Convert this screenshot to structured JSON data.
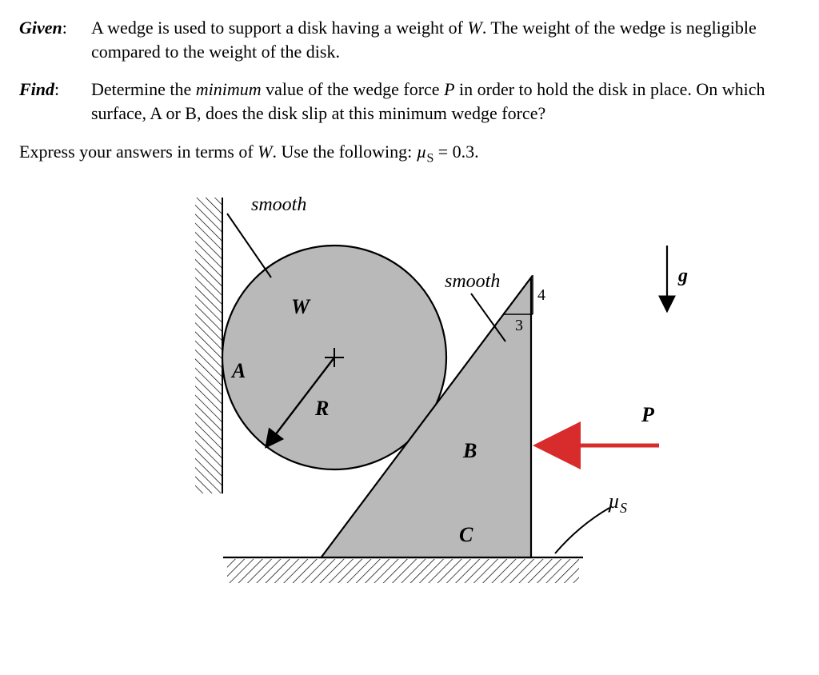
{
  "given": {
    "label": "Given",
    "text_a": "A wedge is used to support a disk having a weight of ",
    "W": "W",
    "text_b": ". The weight of the wedge is negligible compared to the weight of the disk."
  },
  "find": {
    "label": "Find",
    "text_a": "Determine the ",
    "min": "minimum",
    "text_b": " value of the wedge force ",
    "P": "P",
    "text_c": " in order to hold the disk in place. On which surface, A or B, does the disk slip at this minimum wedge force?"
  },
  "express": {
    "text_a": "Express your answers in terms of ",
    "W": "W",
    "text_b": ". Use the following: ",
    "mu": "µ",
    "mu_sub": "S",
    "eq": " = 0.3."
  },
  "figure": {
    "smooth_wall": "smooth",
    "smooth_wedge": "smooth",
    "W": "W",
    "A": "A",
    "R": "R",
    "B": "B",
    "C": "C",
    "P": "P",
    "g": "g",
    "mu": "µ",
    "mu_sub": "S",
    "slope_v": "4",
    "slope_h": "3"
  }
}
